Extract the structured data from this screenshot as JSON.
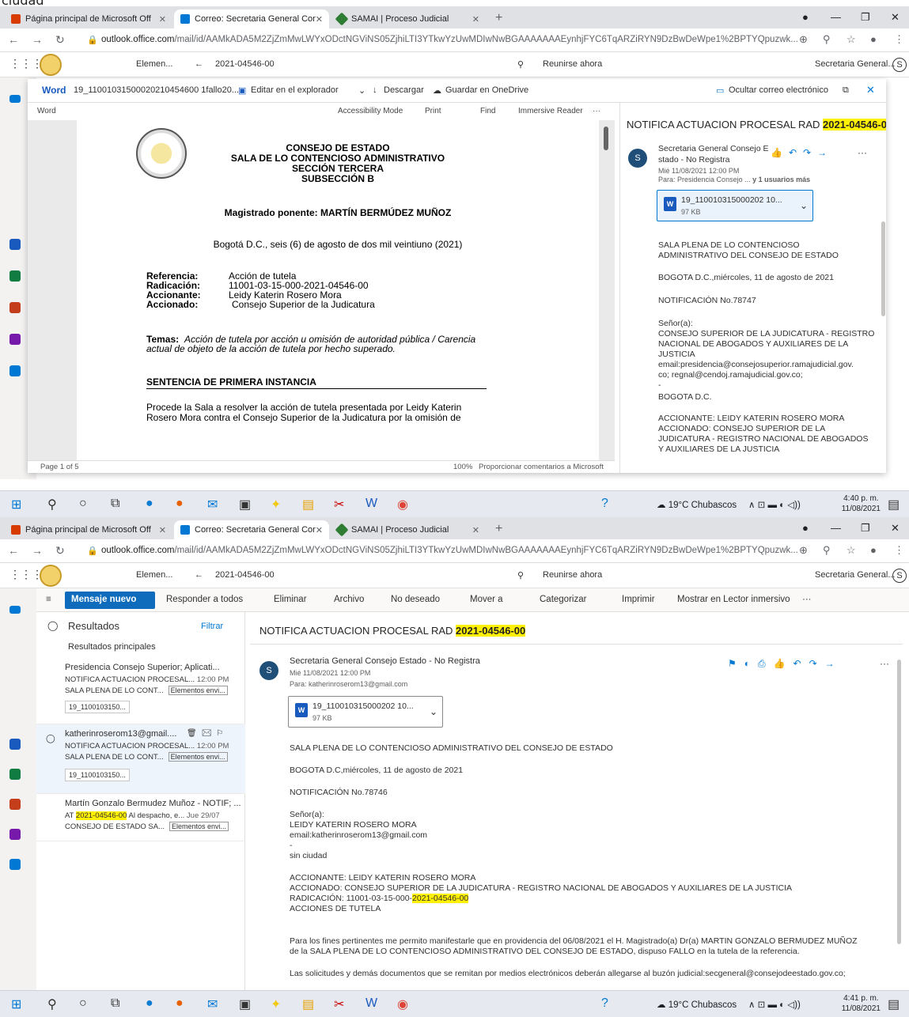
{
  "cut_title": "ciudad",
  "browser": {
    "tabs": [
      {
        "title": "Página principal de Microsoft Off",
        "color": "#d83b01"
      },
      {
        "title": "Correo: Secretaria General Conse",
        "color": "#0078d4"
      },
      {
        "title": "SAMAI | Proceso Judicial",
        "color": "#2e7d32"
      }
    ],
    "url_host": "outlook.office.com",
    "url_path": "/mail/id/AAMkADA5M2ZjZmMwLWYxODctNGViNS05ZjhiLTI3YTkwYzUwMDIwNwBGAAAAAAAEynhjFYC6TqARZiRYN9DzBwDeWpe1%2BPTYQpuzwk..."
  },
  "owa": {
    "folder_label": "Elemen...",
    "search_value": "2021-04546-00",
    "meet_now": "Reunirse ahora",
    "user": "Secretaria General...",
    "avatar_initial": "S",
    "notif_count": "2"
  },
  "word": {
    "app": "Word",
    "file": "19_11001031500020210454600 1fallo20...",
    "edit": "Editar en el explorador",
    "download": "Descargar",
    "save_onedrive": "Guardar en OneDrive",
    "hide_mail": "Ocultar correo electrónico",
    "label": "Word",
    "accessibility": "Accessibility Mode",
    "print": "Print",
    "find": "Find",
    "immersive": "Immersive Reader",
    "page_count": "Page 1 of 5",
    "zoom": "100%",
    "feedback": "Proporcionar comentarios a Microsoft"
  },
  "doc": {
    "l1": "CONSEJO DE ESTADO",
    "l2": "SALA DE LO CONTENCIOSO ADMINISTRATIVO",
    "l3": "SECCIÓN TERCERA",
    "l4": "SUBSECCIÓN B",
    "magistrado": "Magistrado ponente: MARTÍN BERMÚDEZ MUÑOZ",
    "fecha": "Bogotá D.C., seis (6) de agosto de dos mil veintiuno (2021)",
    "ref_k": "Referencia:",
    "ref_v": "Acción de tutela",
    "rad_k": "Radicación:",
    "rad_v": "11001-03-15-000-2021-04546-00",
    "acc_k": "Accionante:",
    "acc_v": "Leidy Katerin Rosero Mora",
    "acd_k": "Accionado:",
    "acd_v": "Consejo Superior de la Judicatura",
    "temas_k": "Temas:",
    "temas_v1": "Acción de tutela por acción u omisión de autoridad pública / Carencia",
    "temas_v2": "actual de objeto de la acción de tutela por hecho superado.",
    "sentencia": "SENTENCIA DE PRIMERA INSTANCIA",
    "p1": "Procede la Sala a resolver la acción de tutela presentada por Leidy Katerin",
    "p2": "Rosero Mora contra el Consejo Superior de la Judicatura por la omisión de"
  },
  "mail1": {
    "subject_pre": "NOTIFICA ACTUACION PROCESAL RAD",
    "subject_rad": "2021-04546-00",
    "from1": "Secretaria General Consejo E",
    "from2": "stado - No Registra",
    "date": "Mié 11/08/2021 12:00 PM",
    "to_label": "Para:",
    "to": "Presidencia Consejo ...",
    "to_more": "y 1 usuarios más",
    "attach_name": "19_110010315000202 10...",
    "attach_size": "97 KB",
    "b1": "SALA PLENA DE LO CONTENCIOSO",
    "b2": "ADMINISTRATIVO DEL CONSEJO DE ESTADO",
    "b3": "BOGOTA D.C.,miércoles, 11 de agosto de 2021",
    "b4": "NOTIFICACIÓN No.78747",
    "b5": "Señor(a):",
    "b6": "CONSEJO SUPERIOR DE LA JUDICATURA - REGISTRO",
    "b7": "NACIONAL DE ABOGADOS Y AUXILIARES DE LA",
    "b8": "JUSTICIA",
    "b9": "email:presidencia@consejosuperior.ramajudicial.gov.",
    "b10": "co; regnal@cendoj.ramajudicial.gov.co;",
    "b11": "-",
    "b12": "BOGOTA D.C.",
    "b13": "ACCIONANTE: LEIDY KATERIN ROSERO MORA",
    "b14": "ACCIONADO: CONSEJO SUPERIOR DE LA",
    "b15": "JUDICATURA - REGISTRO NACIONAL DE ABOGADOS",
    "b16": "Y AUXILIARES DE LA JUSTICIA"
  },
  "taskbar": {
    "weather": "19°C Chubascos",
    "time1": "4:40 p. m.",
    "time2": "4:41 p. m.",
    "date": "11/08/2021"
  },
  "cmd": {
    "new": "Mensaje nuevo",
    "reply_all": "Responder a todos",
    "delete": "Eliminar",
    "archive": "Archivo",
    "junk": "No deseado",
    "move": "Mover a",
    "categorize": "Categorizar",
    "print": "Imprimir",
    "immersive": "Mostrar en Lector inmersivo"
  },
  "list": {
    "results": "Resultados",
    "filter": "Filtrar",
    "top": "Resultados principales",
    "items": [
      {
        "from": "Presidencia Consejo Superior; Aplicati...",
        "subj": "NOTIFICA ACTUACION PROCESAL...",
        "time": "12:00 PM",
        "prev": "SALA PLENA DE LO CONT...",
        "tag": "Elementos envi...",
        "file": "19_1100103150..."
      },
      {
        "from": "katherinroserom13@gmail....",
        "subj": "NOTIFICA ACTUACION PROCESAL...",
        "time": "12:00 PM",
        "prev": "SALA PLENA DE LO CONT...",
        "tag": "Elementos envi...",
        "file": "19_1100103150..."
      },
      {
        "from": "Martín Gonzalo Bermudez Muñoz - NOTIF; ...",
        "subj_pre": "AT",
        "subj_rad": "2021-04546-00",
        "subj_post": "Al despacho, e...",
        "time": "Jue 29/07",
        "prev": "CONSEJO DE ESTADO SA...",
        "tag": "Elementos envi..."
      }
    ]
  },
  "mail2": {
    "subject_pre": "NOTIFICA ACTUACION PROCESAL RAD",
    "subject_rad": "2021-04546-00",
    "from": "Secretaria General Consejo Estado - No Registra",
    "date": "Mié 11/08/2021 12:00 PM",
    "to": "Para: katherinroserom13@gmail.com",
    "attach_name": "19_110010315000202 10...",
    "attach_size": "97 KB",
    "b1": "SALA PLENA DE LO CONTENCIOSO ADMINISTRATIVO DEL CONSEJO DE ESTADO",
    "b2": "BOGOTA D.C,miércoles, 11 de agosto de 2021",
    "b3": "NOTIFICACIÓN No.78746",
    "b4": "Señor(a):",
    "b5": "LEIDY KATERIN ROSERO MORA",
    "b6": "email:katherinroserom13@gmail.com",
    "b7": "-",
    "b8": "sin ciudad",
    "b9": "ACCIONANTE: LEIDY KATERIN ROSERO MORA",
    "b10": "ACCIONADO: CONSEJO SUPERIOR DE LA JUDICATURA - REGISTRO NACIONAL DE ABOGADOS Y AUXILIARES DE LA JUSTICIA",
    "b11_pre": "RADICACIÓN: 11001-03-15-000-",
    "b11_rad": "2021-04546-00",
    "b12": "ACCIONES DE TUTELA",
    "b13": "Para los fines pertinentes me permito manifestarle que en providencia del 06/08/2021  el H. Magistrado(a) Dr(a) MARTIN GONZALO BERMUDEZ MUÑOZ",
    "b14": "de la SALA PLENA DE LO CONTENCIOSO ADMINISTRATIVO DEL CONSEJO DE ESTADO, dispuso FALLO en la tutela de la referencia.",
    "b15": "Las solicitudes y demás documentos que se remitan por medios electrónicos deberán allegarse al buzón judicial:secgeneral@consejodeestado.gov.co;"
  }
}
